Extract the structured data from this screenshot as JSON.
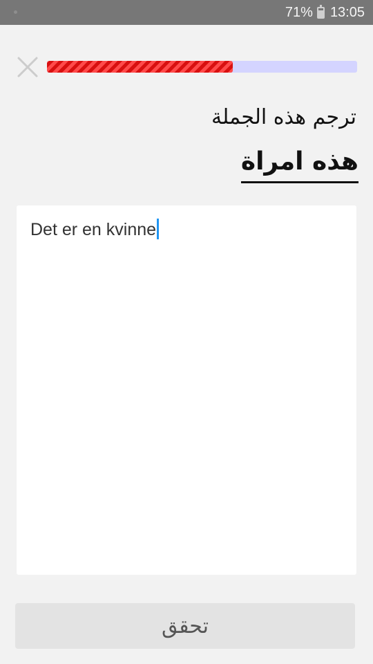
{
  "status_bar": {
    "battery_percent": "71%",
    "battery_level": 0.71,
    "time": "13:05"
  },
  "progress": {
    "fraction": 0.6
  },
  "exercise": {
    "instruction": "ترجم هذه الجملة",
    "prompt": "هذه امراة",
    "answer_value": "Det er en kvinne"
  },
  "check_button": {
    "label": "تحقق"
  },
  "colors": {
    "status_bar_bg": "#777777",
    "progress_fill": "#ef2a2a",
    "progress_track": "#d4d4ff",
    "caret": "#2196f3",
    "button_bg": "#e3e3e3"
  }
}
